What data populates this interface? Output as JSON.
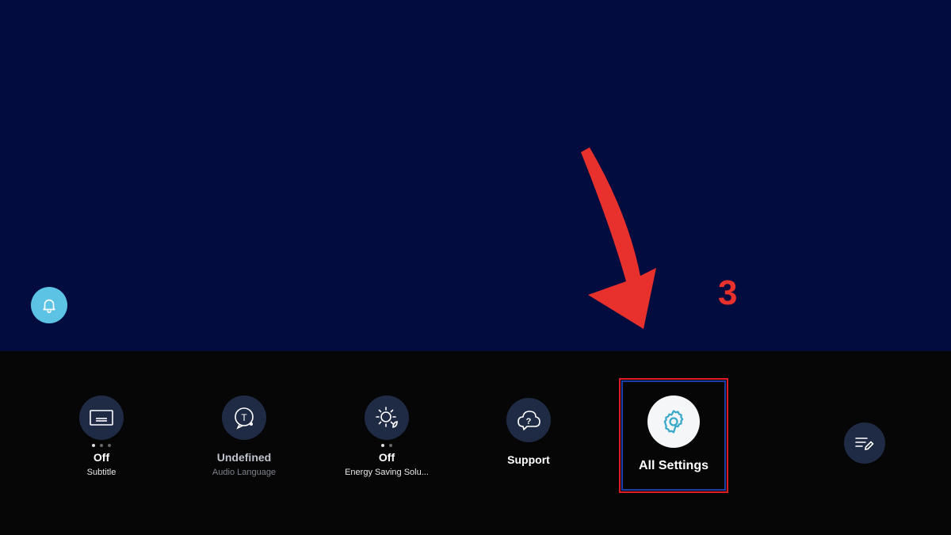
{
  "quick_panel": {
    "items": [
      {
        "value": "Off",
        "label": "Subtitle",
        "icon": "subtitle-icon"
      },
      {
        "value": "Undefined",
        "label": "Audio Language",
        "icon": "audio-language-icon"
      },
      {
        "value": "Off",
        "label": "Energy Saving Solu...",
        "icon": "energy-saving-icon"
      },
      {
        "label": "Support",
        "icon": "support-icon"
      }
    ],
    "focused": {
      "label": "All Settings",
      "icon": "gear-icon"
    },
    "edit_icon": "edit-list-icon"
  },
  "annotation": {
    "step": "3",
    "color": "#e8302c"
  },
  "colors": {
    "accent": "#5cc3e4",
    "screen_bg": "#020c3e",
    "panel_bg": "#060606",
    "highlight_border": "#e01b24"
  }
}
